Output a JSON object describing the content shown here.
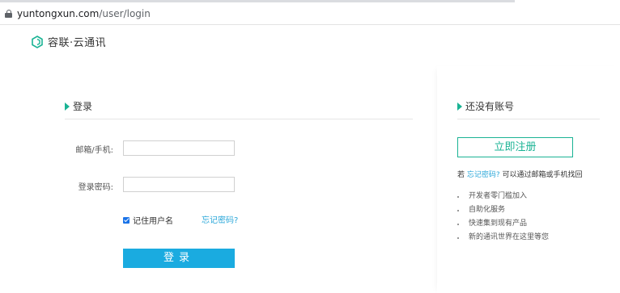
{
  "browser": {
    "url_domain": "yuntongxun.com",
    "url_path": "/user/login"
  },
  "logo": {
    "icon": "ronglian-logo-icon",
    "text": "容联·云通讯",
    "brand_color": "#1ab394"
  },
  "login": {
    "section_title": "登录",
    "email_label": "邮箱/手机:",
    "email_value": "",
    "email_placeholder": "",
    "password_label": "登录密码:",
    "password_value": "",
    "password_placeholder": "",
    "remember_label": "记住用户名",
    "remember_checked": true,
    "forgot_link": "忘记密码?",
    "submit_label": "登录",
    "submit_color": "#1aabe0"
  },
  "register": {
    "section_title": "还没有账号",
    "button_label": "立即注册",
    "hint_prefix": "若",
    "hint_link": "忘记密码?",
    "hint_suffix": "可以通过邮箱或手机找回",
    "features": [
      "开发者零门槛加入",
      "自助化服务",
      "快速集到现有产品",
      "新的通讯世界在这里等您"
    ]
  }
}
